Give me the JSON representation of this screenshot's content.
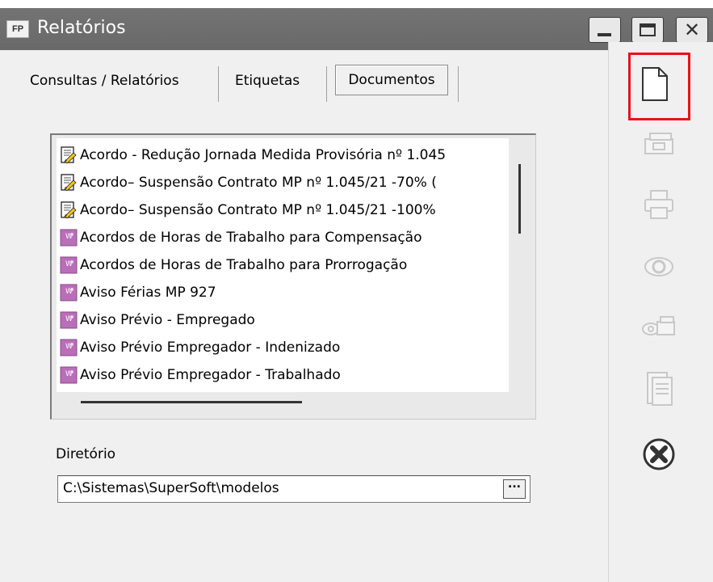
{
  "window": {
    "app_icon": "FP",
    "title": "Relatórios"
  },
  "tabs": [
    {
      "label": "Consultas / Relatórios"
    },
    {
      "label": "Etiquetas"
    },
    {
      "label": "Documentos",
      "active": true
    }
  ],
  "documents": [
    {
      "label": "Acordo - Redução Jornada Medida Provisória nº 1.045",
      "icon": "doc-edit-icon"
    },
    {
      "label": "Acordo– Suspensão Contrato MP  nº 1.045/21 -70%  (",
      "icon": "doc-edit-icon"
    },
    {
      "label": "Acordo– Suspensão Contrato MP nº 1.045/21 -100%",
      "icon": "doc-edit-icon"
    },
    {
      "label": "Acordos de Horas de Trabalho para Compensação",
      "icon": "template-icon"
    },
    {
      "label": "Acordos de Horas de Trabalho para Prorrogação",
      "icon": "template-icon"
    },
    {
      "label": "Aviso Férias MP 927",
      "icon": "template-icon"
    },
    {
      "label": "Aviso Prévio - Empregado",
      "icon": "template-icon"
    },
    {
      "label": "Aviso Prévio Empregador - Indenizado",
      "icon": "template-icon"
    },
    {
      "label": "Aviso Prévio Empregador - Trabalhado",
      "icon": "template-icon"
    }
  ],
  "directory": {
    "label": "Diretório",
    "value": "C:\\Sistemas\\SuperSoft\\modelos",
    "browse_label": "..."
  },
  "toolbar": [
    {
      "name": "new-document-icon",
      "enabled": true
    },
    {
      "name": "money-icon",
      "enabled": false
    },
    {
      "name": "printer-icon",
      "enabled": false
    },
    {
      "name": "preview-eye-icon",
      "enabled": false
    },
    {
      "name": "preview-money-icon",
      "enabled": false
    },
    {
      "name": "export-document-icon",
      "enabled": false
    },
    {
      "name": "close-circle-icon",
      "enabled": true
    }
  ],
  "colors": {
    "titlebar": "#6e6e6e",
    "highlight": "#e8121a",
    "disabled_icon": "#c8c8c8"
  }
}
